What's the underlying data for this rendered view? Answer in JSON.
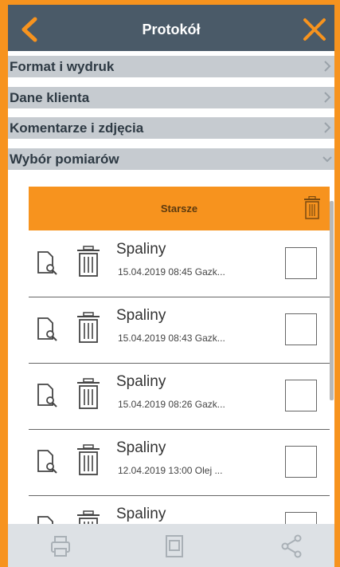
{
  "header": {
    "title": "Protokół",
    "back_icon": "chevron-left-icon",
    "close_icon": "close-icon"
  },
  "sections": [
    {
      "label": "Format i wydruk",
      "state": "collapsed"
    },
    {
      "label": "Dane klienta",
      "state": "collapsed"
    },
    {
      "label": "Komentarze i zdjęcia",
      "state": "collapsed"
    },
    {
      "label": "Wybór pomiarów",
      "state": "expanded"
    }
  ],
  "older_bar": {
    "label": "Starsze",
    "icon": "trash-icon"
  },
  "measurements": [
    {
      "name": "Spaliny",
      "datetime": "15.04.2019  08:45",
      "info": "Gazk...",
      "checked": false
    },
    {
      "name": "Spaliny",
      "datetime": "15.04.2019  08:43",
      "info": "Gazk...",
      "checked": false
    },
    {
      "name": "Spaliny",
      "datetime": "15.04.2019  08:26",
      "info": "Gazk...",
      "checked": false
    },
    {
      "name": "Spaliny",
      "datetime": "12.04.2019  13:00",
      "info": "Olej ...",
      "checked": false
    },
    {
      "name": "Spaliny",
      "datetime": "",
      "info": "",
      "checked": false
    }
  ],
  "bottom_bar": {
    "icons": [
      "print-icon",
      "document-icon",
      "share-icon"
    ],
    "state": "disabled"
  },
  "colors": {
    "accent": "#f7931e",
    "header": "#4a5a68",
    "section": "#c6cbd0"
  }
}
